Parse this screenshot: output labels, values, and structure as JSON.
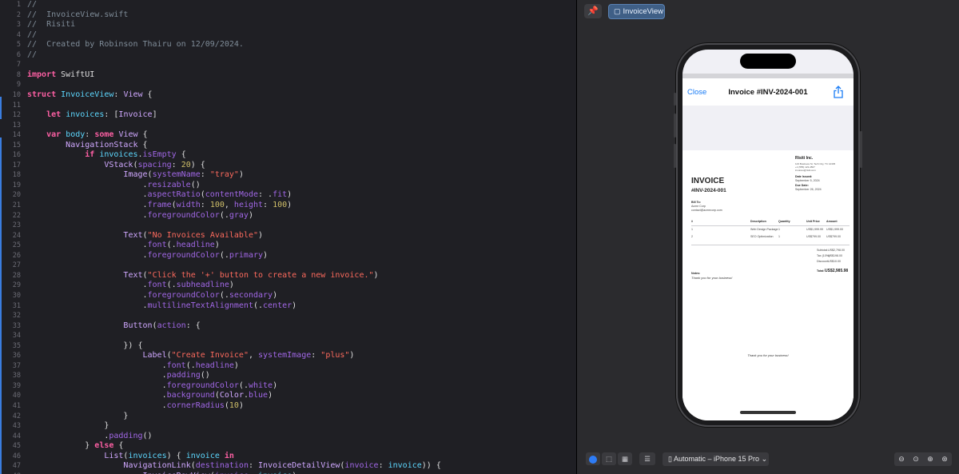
{
  "editor": {
    "lines": [
      {
        "n": "1",
        "tokens": [
          [
            "cm",
            "//"
          ]
        ]
      },
      {
        "n": "2",
        "tokens": [
          [
            "cm",
            "//  InvoiceView.swift"
          ]
        ]
      },
      {
        "n": "3",
        "tokens": [
          [
            "cm",
            "//  Risiti"
          ]
        ]
      },
      {
        "n": "4",
        "tokens": [
          [
            "cm",
            "//"
          ]
        ]
      },
      {
        "n": "5",
        "tokens": [
          [
            "cm",
            "//  Created by Robinson Thairu on 12/09/2024."
          ]
        ]
      },
      {
        "n": "6",
        "tokens": [
          [
            "cm",
            "//"
          ]
        ]
      },
      {
        "n": "7",
        "tokens": []
      },
      {
        "n": "8",
        "tokens": [
          [
            "kw",
            "import"
          ],
          [
            "pl",
            " SwiftUI"
          ]
        ]
      },
      {
        "n": "9",
        "tokens": []
      },
      {
        "n": "10",
        "tokens": [
          [
            "kw",
            "struct"
          ],
          [
            "pl",
            " "
          ],
          [
            "ty",
            "InvoiceView"
          ],
          [
            "pl",
            ": "
          ],
          [
            "fn",
            "View"
          ],
          [
            "pl",
            " {"
          ]
        ]
      },
      {
        "n": "11",
        "tokens": []
      },
      {
        "n": "12",
        "tokens": [
          [
            "pl",
            "    "
          ],
          [
            "kw",
            "let"
          ],
          [
            "pl",
            " "
          ],
          [
            "ty",
            "invoices"
          ],
          [
            "pl",
            ": ["
          ],
          [
            "fn",
            "Invoice"
          ],
          [
            "pl",
            "]"
          ]
        ]
      },
      {
        "n": "13",
        "tokens": []
      },
      {
        "n": "14",
        "tokens": [
          [
            "pl",
            "    "
          ],
          [
            "kw",
            "var"
          ],
          [
            "pl",
            " "
          ],
          [
            "ty",
            "body"
          ],
          [
            "pl",
            ": "
          ],
          [
            "kw",
            "some"
          ],
          [
            "pl",
            " "
          ],
          [
            "fn",
            "View"
          ],
          [
            "pl",
            " {"
          ]
        ]
      },
      {
        "n": "15",
        "tokens": [
          [
            "pl",
            "        "
          ],
          [
            "fn",
            "NavigationStack"
          ],
          [
            "pl",
            " {"
          ]
        ]
      },
      {
        "n": "16",
        "tokens": [
          [
            "pl",
            "            "
          ],
          [
            "kw",
            "if"
          ],
          [
            "pl",
            " "
          ],
          [
            "ty",
            "invoices"
          ],
          [
            "pl",
            "."
          ],
          [
            "pr",
            "isEmpty"
          ],
          [
            "pl",
            " {"
          ]
        ]
      },
      {
        "n": "17",
        "tokens": [
          [
            "pl",
            "                "
          ],
          [
            "fn",
            "VStack"
          ],
          [
            "pl",
            "("
          ],
          [
            "pr",
            "spacing"
          ],
          [
            "pl",
            ": "
          ],
          [
            "nu",
            "20"
          ],
          [
            "pl",
            ") {"
          ]
        ]
      },
      {
        "n": "18",
        "tokens": [
          [
            "pl",
            "                    "
          ],
          [
            "fn",
            "Image"
          ],
          [
            "pl",
            "("
          ],
          [
            "pr",
            "systemName"
          ],
          [
            "pl",
            ": "
          ],
          [
            "st",
            "\"tray\""
          ],
          [
            "pl",
            ")"
          ]
        ]
      },
      {
        "n": "19",
        "tokens": [
          [
            "pl",
            "                        ."
          ],
          [
            "pr",
            "resizable"
          ],
          [
            "pl",
            "()"
          ]
        ]
      },
      {
        "n": "20",
        "tokens": [
          [
            "pl",
            "                        ."
          ],
          [
            "pr",
            "aspectRatio"
          ],
          [
            "pl",
            "("
          ],
          [
            "pr",
            "contentMode"
          ],
          [
            "pl",
            ": ."
          ],
          [
            "pr",
            "fit"
          ],
          [
            "pl",
            ")"
          ]
        ]
      },
      {
        "n": "21",
        "tokens": [
          [
            "pl",
            "                        ."
          ],
          [
            "pr",
            "frame"
          ],
          [
            "pl",
            "("
          ],
          [
            "pr",
            "width"
          ],
          [
            "pl",
            ": "
          ],
          [
            "nu",
            "100"
          ],
          [
            "pl",
            ", "
          ],
          [
            "pr",
            "height"
          ],
          [
            "pl",
            ": "
          ],
          [
            "nu",
            "100"
          ],
          [
            "pl",
            ")"
          ]
        ]
      },
      {
        "n": "22",
        "tokens": [
          [
            "pl",
            "                        ."
          ],
          [
            "pr",
            "foregroundColor"
          ],
          [
            "pl",
            "(."
          ],
          [
            "pr",
            "gray"
          ],
          [
            "pl",
            ")"
          ]
        ]
      },
      {
        "n": "23",
        "tokens": []
      },
      {
        "n": "24",
        "tokens": [
          [
            "pl",
            "                    "
          ],
          [
            "fn",
            "Text"
          ],
          [
            "pl",
            "("
          ],
          [
            "st",
            "\"No Invoices Available\""
          ],
          [
            "pl",
            ")"
          ]
        ]
      },
      {
        "n": "25",
        "tokens": [
          [
            "pl",
            "                        ."
          ],
          [
            "pr",
            "font"
          ],
          [
            "pl",
            "(."
          ],
          [
            "pr",
            "headline"
          ],
          [
            "pl",
            ")"
          ]
        ]
      },
      {
        "n": "26",
        "tokens": [
          [
            "pl",
            "                        ."
          ],
          [
            "pr",
            "foregroundColor"
          ],
          [
            "pl",
            "(."
          ],
          [
            "pr",
            "primary"
          ],
          [
            "pl",
            ")"
          ]
        ]
      },
      {
        "n": "27",
        "tokens": []
      },
      {
        "n": "28",
        "tokens": [
          [
            "pl",
            "                    "
          ],
          [
            "fn",
            "Text"
          ],
          [
            "pl",
            "("
          ],
          [
            "st",
            "\"Click the '+' button to create a new invoice.\""
          ],
          [
            "pl",
            ")"
          ]
        ]
      },
      {
        "n": "29",
        "tokens": [
          [
            "pl",
            "                        ."
          ],
          [
            "pr",
            "font"
          ],
          [
            "pl",
            "(."
          ],
          [
            "pr",
            "subheadline"
          ],
          [
            "pl",
            ")"
          ]
        ]
      },
      {
        "n": "30",
        "tokens": [
          [
            "pl",
            "                        ."
          ],
          [
            "pr",
            "foregroundColor"
          ],
          [
            "pl",
            "(."
          ],
          [
            "pr",
            "secondary"
          ],
          [
            "pl",
            ")"
          ]
        ]
      },
      {
        "n": "31",
        "tokens": [
          [
            "pl",
            "                        ."
          ],
          [
            "pr",
            "multilineTextAlignment"
          ],
          [
            "pl",
            "(."
          ],
          [
            "pr",
            "center"
          ],
          [
            "pl",
            ")"
          ]
        ]
      },
      {
        "n": "32",
        "tokens": []
      },
      {
        "n": "33",
        "tokens": [
          [
            "pl",
            "                    "
          ],
          [
            "fn",
            "Button"
          ],
          [
            "pl",
            "("
          ],
          [
            "pr",
            "action"
          ],
          [
            "pl",
            ": {"
          ]
        ]
      },
      {
        "n": "34",
        "tokens": []
      },
      {
        "n": "35",
        "tokens": [
          [
            "pl",
            "                    }) {"
          ]
        ]
      },
      {
        "n": "36",
        "tokens": [
          [
            "pl",
            "                        "
          ],
          [
            "fn",
            "Label"
          ],
          [
            "pl",
            "("
          ],
          [
            "st",
            "\"Create Invoice\""
          ],
          [
            "pl",
            ", "
          ],
          [
            "pr",
            "systemImage"
          ],
          [
            "pl",
            ": "
          ],
          [
            "st",
            "\"plus\""
          ],
          [
            "pl",
            ")"
          ]
        ]
      },
      {
        "n": "37",
        "tokens": [
          [
            "pl",
            "                            ."
          ],
          [
            "pr",
            "font"
          ],
          [
            "pl",
            "(."
          ],
          [
            "pr",
            "headline"
          ],
          [
            "pl",
            ")"
          ]
        ]
      },
      {
        "n": "38",
        "tokens": [
          [
            "pl",
            "                            ."
          ],
          [
            "pr",
            "padding"
          ],
          [
            "pl",
            "()"
          ]
        ]
      },
      {
        "n": "39",
        "tokens": [
          [
            "pl",
            "                            ."
          ],
          [
            "pr",
            "foregroundColor"
          ],
          [
            "pl",
            "(."
          ],
          [
            "pr",
            "white"
          ],
          [
            "pl",
            ")"
          ]
        ]
      },
      {
        "n": "40",
        "tokens": [
          [
            "pl",
            "                            ."
          ],
          [
            "pr",
            "background"
          ],
          [
            "pl",
            "("
          ],
          [
            "fn",
            "Color"
          ],
          [
            "pl",
            "."
          ],
          [
            "pr",
            "blue"
          ],
          [
            "pl",
            ")"
          ]
        ]
      },
      {
        "n": "41",
        "tokens": [
          [
            "pl",
            "                            ."
          ],
          [
            "pr",
            "cornerRadius"
          ],
          [
            "pl",
            "("
          ],
          [
            "nu",
            "10"
          ],
          [
            "pl",
            ")"
          ]
        ]
      },
      {
        "n": "42",
        "tokens": [
          [
            "pl",
            "                    }"
          ]
        ]
      },
      {
        "n": "43",
        "tokens": [
          [
            "pl",
            "                }"
          ]
        ]
      },
      {
        "n": "44",
        "tokens": [
          [
            "pl",
            "                ."
          ],
          [
            "pr",
            "padding"
          ],
          [
            "pl",
            "()"
          ]
        ]
      },
      {
        "n": "45",
        "tokens": [
          [
            "pl",
            "            } "
          ],
          [
            "kw",
            "else"
          ],
          [
            "pl",
            " {"
          ]
        ]
      },
      {
        "n": "46",
        "tokens": [
          [
            "pl",
            "                "
          ],
          [
            "fn",
            "List"
          ],
          [
            "pl",
            "("
          ],
          [
            "ty",
            "invoices"
          ],
          [
            "pl",
            ") { "
          ],
          [
            "ty",
            "invoice"
          ],
          [
            "pl",
            " "
          ],
          [
            "kw",
            "in"
          ]
        ]
      },
      {
        "n": "47",
        "tokens": [
          [
            "pl",
            "                    "
          ],
          [
            "fn",
            "NavigationLink"
          ],
          [
            "pl",
            "("
          ],
          [
            "pr",
            "destination"
          ],
          [
            "pl",
            ": "
          ],
          [
            "fn",
            "InvoiceDetailView"
          ],
          [
            "pl",
            "("
          ],
          [
            "pr",
            "invoice"
          ],
          [
            "pl",
            ": "
          ],
          [
            "ty",
            "invoice"
          ],
          [
            "pl",
            ")) {"
          ]
        ]
      },
      {
        "n": "48",
        "tokens": [
          [
            "pl",
            "                        "
          ],
          [
            "fn",
            "InvoiceRowView"
          ],
          [
            "pl",
            "("
          ],
          [
            "pr",
            "invoice"
          ],
          [
            "pl",
            ": "
          ],
          [
            "ty",
            "invoice"
          ],
          [
            "pl",
            ")"
          ]
        ]
      }
    ]
  },
  "preview": {
    "pin_icon": "pin-icon",
    "tab_label": "InvoiceView",
    "nav": {
      "close_label": "Close",
      "title": "Invoice #INV-2024-001",
      "share_icon": "share-icon"
    },
    "invoice": {
      "company": "Risiti Inc.",
      "company_lines": [
        "123 Business St, Tech City, TC 12345",
        "+1 (555) 123-4567",
        "invoices@risiti.com"
      ],
      "heading": "INVOICE",
      "number": "#INV-2024-001",
      "date_issued_label": "Date Issued:",
      "date_issued": "September 5, 2024",
      "due_date_label": "Due Date:",
      "due_date": "September 26, 2024",
      "bill_to_label": "Bill To:",
      "bill_to_name": "Acme Corp",
      "bill_to_email": "contact@acmecorp.com",
      "columns": [
        "#",
        "Description",
        "Quantity",
        "Unit Price",
        "Amount"
      ],
      "rows": [
        {
          "n": "1",
          "desc": "Web Design Package",
          "qty": "1",
          "unit": "US$1,999.99",
          "amount": "US$1,999.00"
        },
        {
          "n": "2",
          "desc": "SEO Optimization",
          "qty": "1",
          "unit": "US$799.00",
          "amount": "US$799.00"
        }
      ],
      "subtotal_label": "Subtotal:",
      "subtotal": "US$2,798.00",
      "tax_label": "Tax (10%):",
      "tax": "US$198.00",
      "discount_label": "Discount:",
      "discount": "US$10.00",
      "total_label": "Total:",
      "total": "US$2,985.98",
      "notes_label": "Notes:",
      "notes": "Thank you for your business!",
      "footer": "Thank you for your business!"
    },
    "toolbar": {
      "live_icon": "live-preview-icon",
      "select_icon": "selectable-icon",
      "variants_icon": "variants-icon",
      "settings_icon": "device-settings-icon",
      "device_label": "Automatic – iPhone 15 Pro",
      "zoom_icons": [
        "zoom-out-icon",
        "zoom-100-icon",
        "zoom-in-icon",
        "zoom-fit-icon"
      ]
    }
  }
}
